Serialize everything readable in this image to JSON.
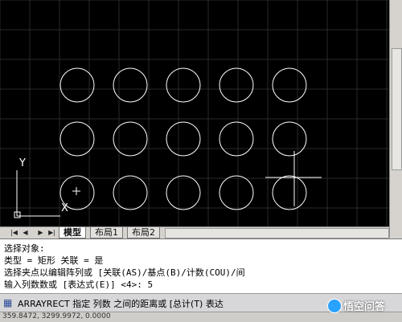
{
  "layout_tabs": {
    "nav_buttons": [
      "|◀",
      "◀",
      "▶",
      "▶|"
    ],
    "tabs": [
      {
        "label": "模型",
        "active": true
      },
      {
        "label": "布局1",
        "active": false
      },
      {
        "label": "布局2",
        "active": false
      }
    ]
  },
  "ucs": {
    "y_label": "Y",
    "x_label": "X"
  },
  "array": {
    "rows": 3,
    "columns": 5
  },
  "history": {
    "lines": [
      "选择对象:",
      "类型 = 矩形  关联 = 是",
      "选择夹点以编辑阵列或 [关联(AS)/基点(B)/计数(COU)/间",
      "输入列数数或 [表达式(E)] <4>: 5"
    ]
  },
  "command_line": {
    "prompt": "ARRAYRECT 指定 列数 之间的距离或 [总计(T) 表达"
  },
  "status_bar": {
    "coords": "359.8472, 3299.9972, 0.0000"
  },
  "watermark": {
    "text": "悟空问答"
  }
}
